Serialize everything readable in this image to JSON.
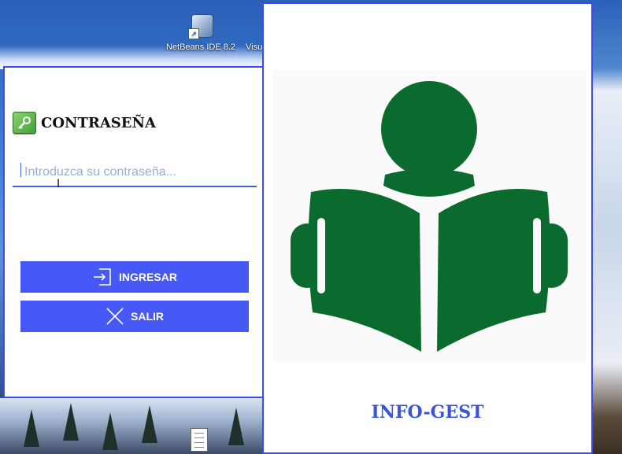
{
  "desktop": {
    "icons": [
      {
        "label": "NetBeans IDE 8.2",
        "icon": "netbeans-icon"
      },
      {
        "label": "Visu",
        "icon": "app-icon"
      }
    ]
  },
  "login": {
    "title": "CONTRASEÑA",
    "title_icon": "key-icon",
    "password_placeholder": "Introduzca su contraseña...",
    "password_value": "",
    "buttons": {
      "enter_label": "INGRESAR",
      "enter_icon": "login-arrow-icon",
      "exit_label": "SALIR",
      "exit_icon": "close-icon"
    }
  },
  "splash": {
    "brand": "INFO-GEST",
    "logo_icon": "reader-book-logo"
  },
  "colors": {
    "accent": "#4658f5",
    "border": "#3b4bf0",
    "logo_green": "#0b6b2e",
    "brand_text": "#3c55d6",
    "placeholder": "#98aecf"
  }
}
